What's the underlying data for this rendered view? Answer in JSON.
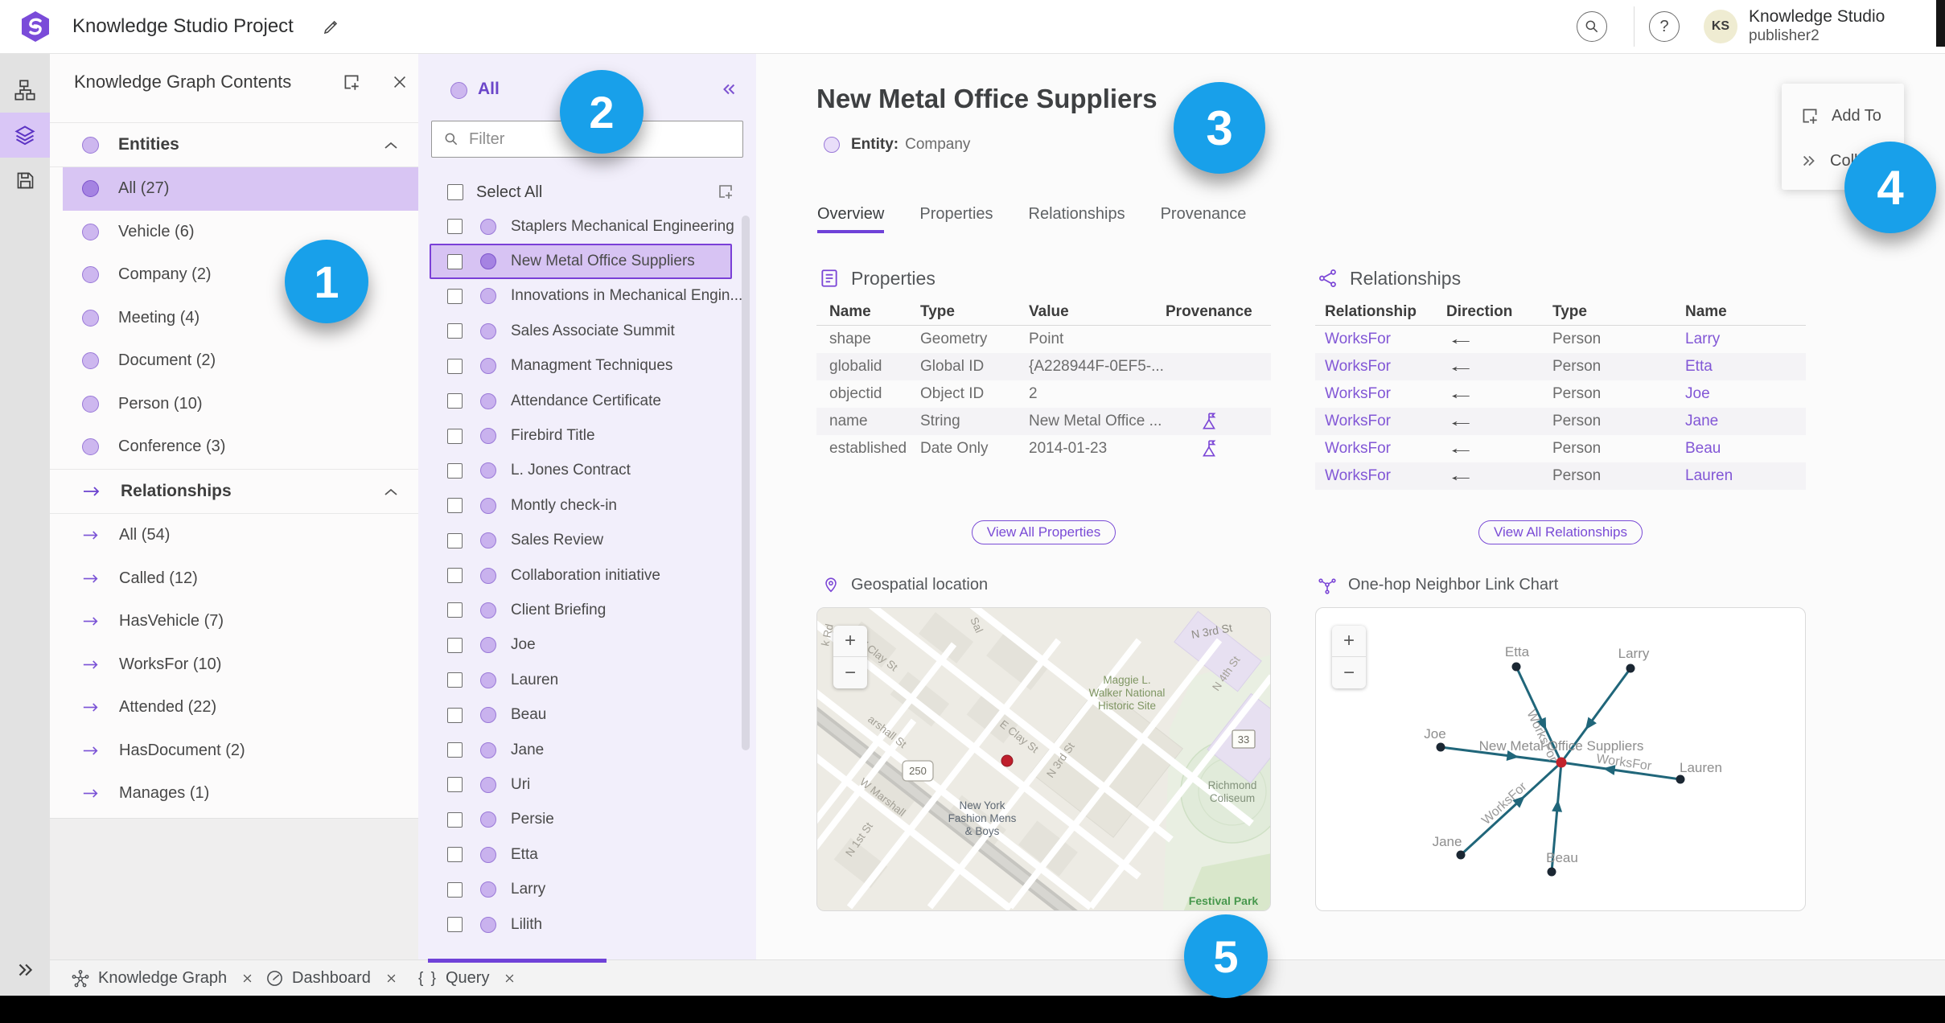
{
  "top_bar": {
    "title": "Knowledge Studio Project",
    "help": "?",
    "avatar_initials": "KS",
    "user_name": "Knowledge Studio",
    "user_role": "publisher2"
  },
  "contents_panel": {
    "title": "Knowledge Graph Contents",
    "entities": {
      "header": "Entities",
      "items": [
        {
          "label": "All (27)",
          "selected": true
        },
        {
          "label": "Vehicle (6)"
        },
        {
          "label": "Company (2)"
        },
        {
          "label": "Meeting (4)"
        },
        {
          "label": "Document (2)"
        },
        {
          "label": "Person (10)"
        },
        {
          "label": "Conference (3)"
        }
      ]
    },
    "relationships": {
      "header": "Relationships",
      "items": [
        {
          "label": "All (54)"
        },
        {
          "label": "Called (12)"
        },
        {
          "label": "HasVehicle (7)"
        },
        {
          "label": "WorksFor (10)"
        },
        {
          "label": "Attended (22)"
        },
        {
          "label": "HasDocument (2)"
        },
        {
          "label": "Manages (1)"
        }
      ]
    }
  },
  "list_panel": {
    "header": "All",
    "filter_placeholder": "Filter",
    "select_all_label": "Select All",
    "items": [
      {
        "label": "Staplers Mechanical Engineering"
      },
      {
        "label": "New Metal Office Suppliers",
        "selected": true
      },
      {
        "label": "Innovations in Mechanical Engin..."
      },
      {
        "label": "Sales Associate Summit"
      },
      {
        "label": "Managment Techniques"
      },
      {
        "label": "Attendance Certificate"
      },
      {
        "label": "Firebird Title"
      },
      {
        "label": "L. Jones Contract"
      },
      {
        "label": "Montly check-in"
      },
      {
        "label": "Sales Review"
      },
      {
        "label": "Collaboration initiative"
      },
      {
        "label": "Client Briefing"
      },
      {
        "label": "Joe"
      },
      {
        "label": "Lauren"
      },
      {
        "label": "Beau"
      },
      {
        "label": "Jane"
      },
      {
        "label": "Uri"
      },
      {
        "label": "Persie"
      },
      {
        "label": "Etta"
      },
      {
        "label": "Larry"
      },
      {
        "label": "Lilith"
      }
    ]
  },
  "detail": {
    "title": "New Metal Office Suppliers",
    "entity_label": "Entity:",
    "entity_type": "Company",
    "tabs": [
      {
        "label": "Overview",
        "selected": true
      },
      {
        "label": "Properties"
      },
      {
        "label": "Relationships"
      },
      {
        "label": "Provenance"
      }
    ],
    "properties": {
      "heading": "Properties",
      "columns": {
        "name": "Name",
        "type": "Type",
        "value": "Value",
        "provenance": "Provenance"
      },
      "rows": [
        {
          "name": "shape",
          "type": "Geometry",
          "value": "Point"
        },
        {
          "name": "globalid",
          "type": "Global ID",
          "value": "{A228944F-0EF5-..."
        },
        {
          "name": "objectid",
          "type": "Object ID",
          "value": "2"
        },
        {
          "name": "name",
          "type": "String",
          "value": "New Metal Office ...",
          "flag": true
        },
        {
          "name": "established",
          "type": "Date Only",
          "value": "2014-01-23",
          "flag": true
        }
      ],
      "view_all": "View All Properties"
    },
    "relationships": {
      "heading": "Relationships",
      "columns": {
        "relationship": "Relationship",
        "direction": "Direction",
        "type": "Type",
        "name": "Name"
      },
      "rows": [
        {
          "relationship": "WorksFor",
          "direction": "←",
          "type": "Person",
          "name": "Larry"
        },
        {
          "relationship": "WorksFor",
          "direction": "←",
          "type": "Person",
          "name": "Etta"
        },
        {
          "relationship": "WorksFor",
          "direction": "←",
          "type": "Person",
          "name": "Joe"
        },
        {
          "relationship": "WorksFor",
          "direction": "←",
          "type": "Person",
          "name": "Jane"
        },
        {
          "relationship": "WorksFor",
          "direction": "←",
          "type": "Person",
          "name": "Beau"
        },
        {
          "relationship": "WorksFor",
          "direction": "←",
          "type": "Person",
          "name": "Lauren"
        }
      ],
      "view_all": "View All Relationships"
    },
    "map": {
      "heading": "Geospatial location",
      "zoom_in": "+",
      "zoom_out": "−",
      "labels": {
        "k_rd": "k Rd",
        "w_clay": "W Clay St",
        "sal": "Sal",
        "n3rd_top": "N 3rd St",
        "n4th": "N 4th St",
        "maggie1": "Maggie L.",
        "maggie2": "Walker National",
        "maggie3": "Historic Site",
        "marshall_a": "arshall St",
        "marshall_b": "W Marshall",
        "e_clay": "E Clay St",
        "n3rd_mid": "N 3rd St",
        "route250": "250",
        "ny1": "New York",
        "ny2": "Fashion Mens",
        "ny3": "& Boys",
        "n1st": "N 1st St",
        "route33": "33",
        "richmond1": "Richmond",
        "richmond2": "Coliseum",
        "festival": "Festival Park"
      }
    },
    "link_chart": {
      "heading": "One-hop Neighbor Link Chart",
      "zoom_in": "+",
      "zoom_out": "−",
      "center_label": "New Metal Office Suppliers",
      "edge_label": "WorksFor",
      "nodes": [
        "Etta",
        "Larry",
        "Joe",
        "Lauren",
        "Jane",
        "Beau"
      ]
    }
  },
  "flyout": {
    "add_to": "Add To",
    "collapse": "Colla"
  },
  "bottom_tabs": {
    "knowledge_graph": "Knowledge Graph",
    "dashboard": "Dashboard",
    "query": "Query",
    "query_icon": "{ }"
  },
  "callouts": [
    "1",
    "2",
    "3",
    "4",
    "5"
  ]
}
